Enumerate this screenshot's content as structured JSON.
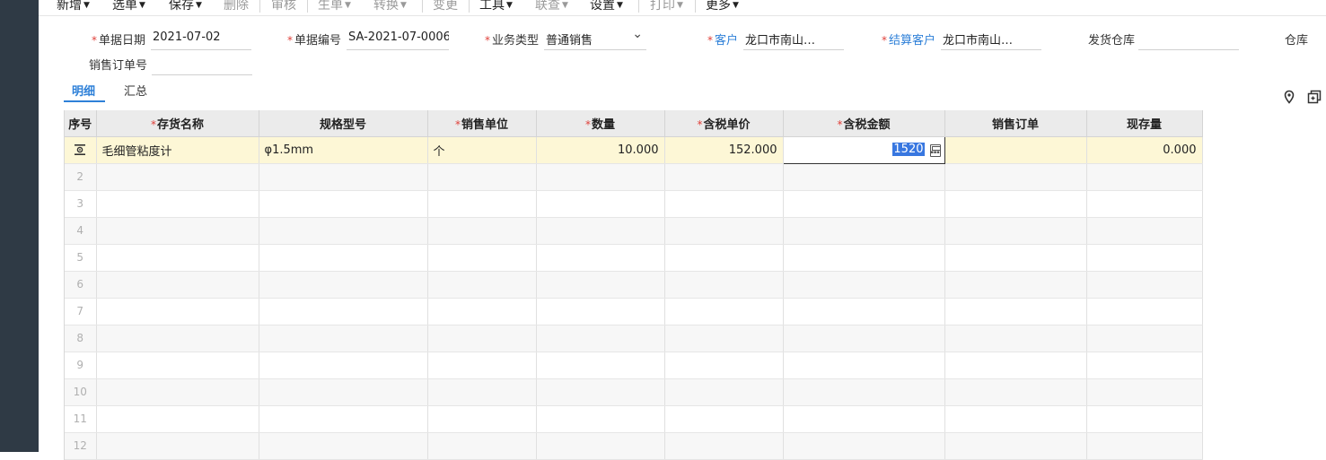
{
  "toolbar": {
    "items": [
      {
        "label": "新增",
        "disabled": false
      },
      {
        "label": "选单",
        "disabled": false
      },
      {
        "label": "保存",
        "disabled": false
      },
      {
        "label": "删除",
        "disabled": true
      },
      {
        "label": "审核",
        "disabled": true
      },
      {
        "label": "生单",
        "disabled": true
      },
      {
        "label": "转换",
        "disabled": true
      },
      {
        "label": "变更",
        "disabled": true
      },
      {
        "label": "工具",
        "disabled": false
      },
      {
        "label": "联查",
        "disabled": true
      },
      {
        "label": "设置",
        "disabled": false
      },
      {
        "label": "打印",
        "disabled": true
      },
      {
        "label": "更多",
        "disabled": false
      }
    ]
  },
  "header": {
    "doc_date": {
      "label": "单据日期",
      "value": "2021-07-02"
    },
    "doc_no": {
      "label": "单据编号",
      "value": "SA-2021-07-0006"
    },
    "biz_type": {
      "label": "业务类型",
      "value": "普通销售"
    },
    "customer": {
      "label": "客户",
      "value": "龙口市南山…"
    },
    "settle_customer": {
      "label": "结算客户",
      "value": "龙口市南山…"
    },
    "warehouse": {
      "label": "发货仓库",
      "value": ""
    },
    "warehouse_cut": {
      "label": "仓库"
    },
    "sales_order_no": {
      "label": "销售订单号",
      "value": ""
    }
  },
  "tabs": [
    {
      "label": "明细",
      "active": true
    },
    {
      "label": "汇总",
      "active": false
    }
  ],
  "side_icons": [
    "location-pin-icon",
    "layers-icon"
  ],
  "grid": {
    "columns": [
      {
        "label": "序号",
        "required": false
      },
      {
        "label": "存货名称",
        "required": true
      },
      {
        "label": "规格型号",
        "required": false
      },
      {
        "label": "销售单位",
        "required": true
      },
      {
        "label": "数量",
        "required": true
      },
      {
        "label": "含税单价",
        "required": true
      },
      {
        "label": "含税金额",
        "required": true
      },
      {
        "label": "销售订单",
        "required": false
      },
      {
        "label": "现存量",
        "required": false
      }
    ],
    "row1": {
      "name": "毛细管粘度计",
      "spec": "φ1.5mm",
      "unit": "个",
      "qty": "10.000",
      "price": "152.000",
      "amount": "1520",
      "order": "",
      "stock": "0.000"
    },
    "row_numbers": [
      "2",
      "3",
      "4",
      "5",
      "6",
      "7",
      "8",
      "9",
      "10",
      "11",
      "12"
    ]
  },
  "colors": {
    "accent": "#2e80d8",
    "required": "#e0403a",
    "active_row": "#fdf7d6",
    "left_rail": "#2f3a45"
  }
}
